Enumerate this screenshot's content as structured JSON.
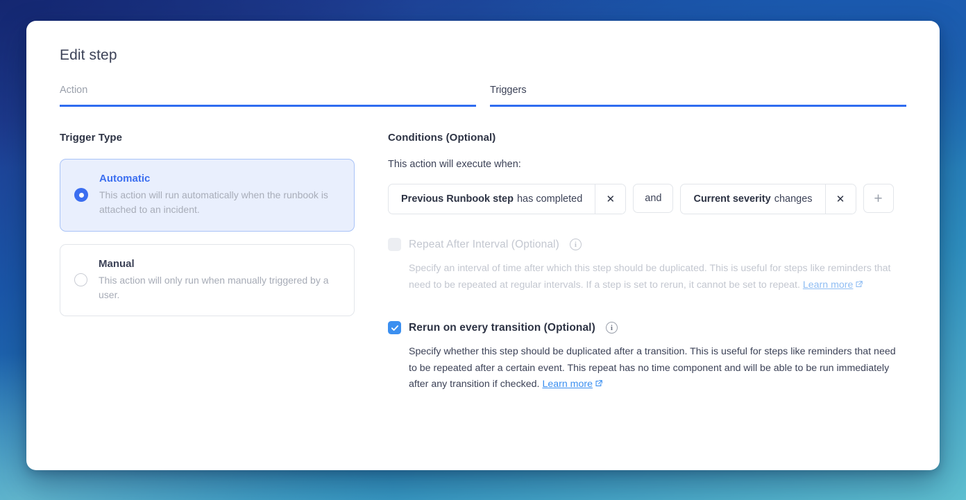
{
  "theme": {
    "accent_blue": "#2f6cf0",
    "link_blue": "#3b8ff0",
    "selected_bg": "#e9effd",
    "text_dark": "#3c4257",
    "muted": "#a6abb6",
    "disabled": "#c3c7d0"
  },
  "card": {
    "title": "Edit step"
  },
  "tabs": [
    {
      "label": "Action",
      "active": false
    },
    {
      "label": "Triggers",
      "active": true
    }
  ],
  "trigger_type": {
    "heading": "Trigger Type",
    "options": [
      {
        "title": "Automatic",
        "description": "This action will run automatically when the runbook is attached to an incident.",
        "selected": true
      },
      {
        "title": "Manual",
        "description": "This action will only run when manually triggered by a user.",
        "selected": false
      }
    ]
  },
  "conditions": {
    "heading": "Conditions (Optional)",
    "lead": "This action will execute when:",
    "chips": [
      {
        "subject": "Previous Runbook step",
        "predicate": "has completed",
        "remove_label": "✕"
      },
      {
        "subject": "Current severity",
        "predicate": "changes",
        "remove_label": "✕"
      }
    ],
    "conjunction": "and",
    "add_label": "+"
  },
  "options": [
    {
      "label": "Repeat After Interval (Optional)",
      "checked": false,
      "disabled": true,
      "info_label": "i",
      "description": "Specify an interval of time after which this step should be duplicated. This is useful for steps like reminders that need to be repeated at regular intervals. If a step is set to rerun, it cannot be set to repeat.",
      "learn_more": "Learn more"
    },
    {
      "label": "Rerun on every transition (Optional)",
      "checked": true,
      "disabled": false,
      "info_label": "i",
      "description": "Specify whether this step should be duplicated after a transition. This is useful for steps like reminders that need to be repeated after a certain event. This repeat has no time component and will be able to be run immediately after any transition if checked.",
      "learn_more": "Learn more"
    }
  ]
}
